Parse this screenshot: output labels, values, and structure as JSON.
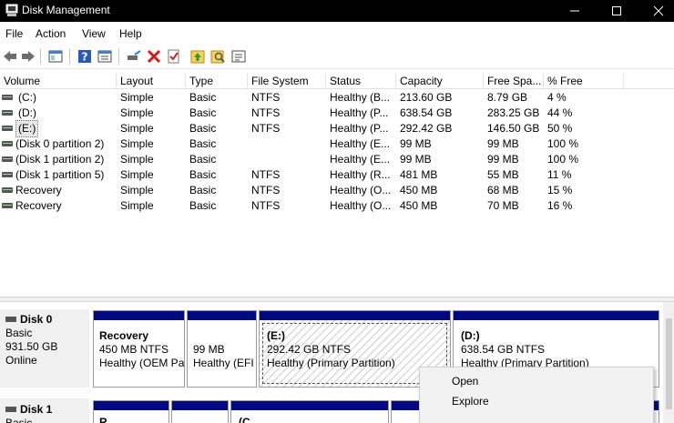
{
  "window": {
    "title": "Disk Management"
  },
  "menu": [
    "File",
    "Action",
    "View",
    "Help"
  ],
  "toolbar": {
    "icons": [
      "back-arrow-icon",
      "forward-arrow-icon",
      "console-view-icon",
      "help-icon",
      "properties-icon",
      "connect-disk-icon",
      "delete-icon",
      "check-icon",
      "import-icon",
      "search-icon",
      "list-icon"
    ]
  },
  "volumes": {
    "columns": [
      "Volume",
      "Layout",
      "Type",
      "File System",
      "Status",
      "Capacity",
      "Free Spa...",
      "% Free"
    ],
    "rows": [
      {
        "volume": "(C:)",
        "layout": "Simple",
        "type": "Basic",
        "fs": "NTFS",
        "status": "Healthy (B...",
        "capacity": "213.60 GB",
        "free": "8.79 GB",
        "pct": "4 %"
      },
      {
        "volume": "(D:)",
        "layout": "Simple",
        "type": "Basic",
        "fs": "NTFS",
        "status": "Healthy (P...",
        "capacity": "638.54 GB",
        "free": "283.25 GB",
        "pct": "44 %"
      },
      {
        "volume": "(E:)",
        "layout": "Simple",
        "type": "Basic",
        "fs": "NTFS",
        "status": "Healthy (P...",
        "capacity": "292.42 GB",
        "free": "146.50 GB",
        "pct": "50 %"
      },
      {
        "volume": "(Disk 0 partition 2)",
        "layout": "Simple",
        "type": "Basic",
        "fs": "",
        "status": "Healthy (E...",
        "capacity": "99 MB",
        "free": "99 MB",
        "pct": "100 %"
      },
      {
        "volume": "(Disk 1 partition 2)",
        "layout": "Simple",
        "type": "Basic",
        "fs": "",
        "status": "Healthy (E...",
        "capacity": "99 MB",
        "free": "99 MB",
        "pct": "100 %"
      },
      {
        "volume": "(Disk 1 partition 5)",
        "layout": "Simple",
        "type": "Basic",
        "fs": "NTFS",
        "status": "Healthy (R...",
        "capacity": "481 MB",
        "free": "55 MB",
        "pct": "11 %"
      },
      {
        "volume": "Recovery",
        "layout": "Simple",
        "type": "Basic",
        "fs": "NTFS",
        "status": "Healthy (O...",
        "capacity": "450 MB",
        "free": "68 MB",
        "pct": "15 %"
      },
      {
        "volume": "Recovery",
        "layout": "Simple",
        "type": "Basic",
        "fs": "NTFS",
        "status": "Healthy (O...",
        "capacity": "450 MB",
        "free": "70 MB",
        "pct": "16 %"
      }
    ]
  },
  "disks": {
    "disk0": {
      "name": "Disk 0",
      "type": "Basic",
      "size": "931.50 GB",
      "state": "Online",
      "partitions": [
        {
          "name": "Recovery",
          "size": "450 MB NTFS",
          "status": "Healthy (OEM Pa"
        },
        {
          "name": "",
          "size": "99 MB",
          "status": "Healthy (EFI"
        },
        {
          "name": "(E:)",
          "size": "292.42 GB NTFS",
          "status": "Healthy (Primary Partition)"
        },
        {
          "name": "(D:)",
          "size": "638.54 GB NTFS",
          "status": "Healthy (Primary Partition)"
        }
      ]
    },
    "disk1": {
      "name": "Disk 1",
      "type": "Basic",
      "partitions": [
        {
          "name": "R"
        },
        {
          "name": ""
        },
        {
          "name": "(C"
        },
        {
          "name": ""
        }
      ]
    }
  },
  "context_menu": [
    "Open",
    "Explore"
  ],
  "colors": {
    "partition_bar": "#000a80",
    "titlebar": "#000000",
    "disk_label_bg": "#f0f0f0"
  }
}
